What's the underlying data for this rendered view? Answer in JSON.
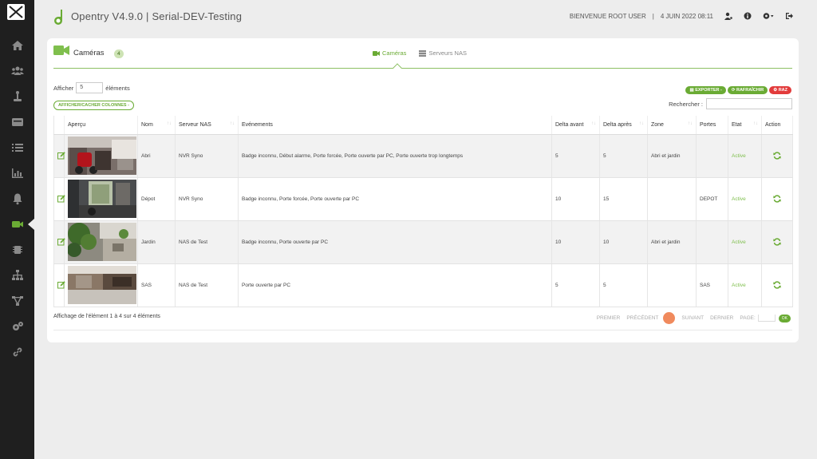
{
  "app": {
    "title": "Opentry V4.9.0 | Serial-DEV-Testing"
  },
  "topbar": {
    "welcome": "BIENVENUE ROOT USER",
    "separator": "|",
    "date": "4 JUIN 2022 08:11"
  },
  "sidebar": {
    "items": [
      "home",
      "users",
      "access",
      "card",
      "list",
      "stats",
      "alerts",
      "cameras",
      "chip",
      "hierarchy",
      "network",
      "settings",
      "link"
    ],
    "active": "cameras"
  },
  "page": {
    "title": "Caméras",
    "count": "4"
  },
  "tabs": [
    {
      "label": "Caméras",
      "active": true
    },
    {
      "label": "Serveurs NAS",
      "active": false
    }
  ],
  "length": {
    "prefix": "Afficher",
    "value": "5",
    "suffix": "éléments"
  },
  "colvis_label": "AFFICHER/CACHER COLONNES -",
  "buttons": {
    "export": "EXPORTER -",
    "refresh": "RAFRAÎCHIR",
    "reset": "RAZ"
  },
  "search": {
    "label": "Rechercher :",
    "value": ""
  },
  "table": {
    "headers": [
      "",
      "Aperçu",
      "Nom",
      "Serveur NAS",
      "Evénements",
      "Delta avant",
      "Delta après",
      "Zone",
      "Portes",
      "Etat",
      "Action"
    ],
    "rows": [
      {
        "nom": "Abri",
        "serveur": "NVR Syno",
        "evenements": "Badge inconnu, Début alarme, Porte forcée, Porte ouverte par PC, Porte ouverte trop longtemps",
        "delta_avant": "5",
        "delta_apres": "5",
        "zone": "Abri et jardin",
        "portes": "",
        "etat": "Active"
      },
      {
        "nom": "Dépot",
        "serveur": "NVR Syno",
        "evenements": "Badge inconnu, Porte forcée, Porte ouverte par PC",
        "delta_avant": "10",
        "delta_apres": "15",
        "zone": "",
        "portes": "DEPOT",
        "etat": "Active"
      },
      {
        "nom": "Jardin",
        "serveur": "NAS de Test",
        "evenements": "Badge inconnu, Porte ouverte par PC",
        "delta_avant": "10",
        "delta_apres": "10",
        "zone": "Abri et jardin",
        "portes": "",
        "etat": "Active"
      },
      {
        "nom": "SAS",
        "serveur": "NAS de Test",
        "evenements": "Porte ouverte par PC",
        "delta_avant": "5",
        "delta_apres": "5",
        "zone": "",
        "portes": "SAS",
        "etat": "Active"
      }
    ]
  },
  "info": "Affichage de l'élément 1 à 4 sur 4 éléments",
  "pagination": {
    "first": "PREMIER",
    "prev": "PRÉCÉDENT",
    "current": "1",
    "next": "SUIVANT",
    "last": "DERNIER",
    "page_label": "PAGE:",
    "ok": "OK"
  },
  "colors": {
    "accent": "#6aab34",
    "danger": "#e23b3b",
    "sidebar": "#1f1f1f",
    "current_page": "#f08a5d"
  }
}
